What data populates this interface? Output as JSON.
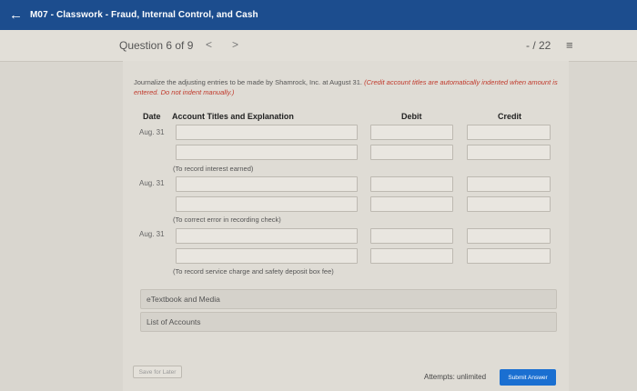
{
  "topbar": {
    "back_icon": "arrow-left-icon",
    "title": "M07 - Classwork - Fraud, Internal Control, and Cash"
  },
  "question_nav": {
    "label": "Question 6 of 9",
    "prev": "<",
    "next": ">",
    "score": "- / 22",
    "list_icon": "list-icon"
  },
  "instructions": {
    "text": "Journalize the adjusting entries to be made by Shamrock, Inc. at August 31.",
    "emphasis": "(Credit account titles are automatically indented when amount is entered. Do not indent manually.)"
  },
  "table": {
    "headers": {
      "date": "Date",
      "account": "Account Titles and Explanation",
      "debit": "Debit",
      "credit": "Credit"
    },
    "entries": [
      {
        "date": "Aug. 31",
        "explanation": "(To record interest earned)"
      },
      {
        "date": "Aug. 31",
        "explanation": "(To correct error in recording check)"
      },
      {
        "date": "Aug. 31",
        "explanation": "(To record service charge and safety deposit box fee)"
      }
    ]
  },
  "panels": {
    "textbook": "eTextbook and Media",
    "accounts": "List of Accounts"
  },
  "footer": {
    "save_label": "Save for Later",
    "attempts": "Attempts: unlimited",
    "submit_label": "Submit Answer"
  }
}
